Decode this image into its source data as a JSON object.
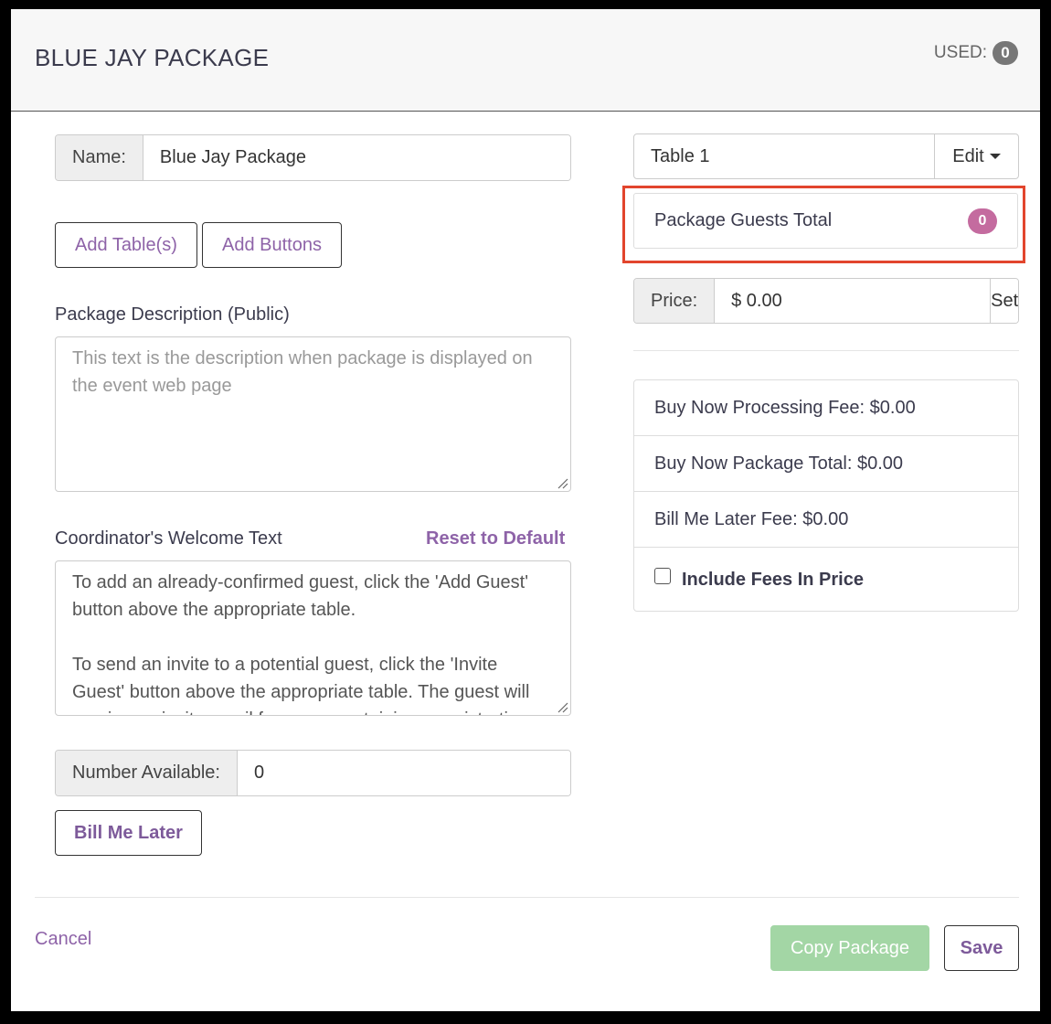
{
  "header": {
    "title": "BLUE JAY PACKAGE",
    "used_label": "USED:",
    "used_count": "0"
  },
  "form": {
    "name_label": "Name:",
    "name_value": "Blue Jay Package",
    "add_tables_label": "Add Table(s)",
    "add_buttons_label": "Add Buttons",
    "description_label": "Package Description (Public)",
    "description_placeholder": "This text is the description when package is displayed on the event web page",
    "welcome_label": "Coordinator's Welcome Text",
    "reset_default_label": "Reset to Default",
    "welcome_text_p1": "To add an already-confirmed guest, click the 'Add Guest' button above the appropriate table.",
    "welcome_text_p2": "To send an invite to a potential guest, click the 'Invite Guest' button above the appropriate table. The guest will receive an invite email from you containing a registration",
    "number_available_label": "Number Available:",
    "number_available_value": "0",
    "bill_me_later_label": "Bill Me Later"
  },
  "side": {
    "table_select_value": "Table 1",
    "edit_label": "Edit",
    "guests_total_label": "Package Guests Total",
    "guests_total_count": "0",
    "price_label": "Price:",
    "price_value": "$ 0.00",
    "set_label": "Set",
    "fees": {
      "processing_fee": "Buy Now Processing Fee: $0.00",
      "package_total": "Buy Now Package Total: $0.00",
      "bill_later_fee": "Bill Me Later Fee: $0.00",
      "include_fees_label": "Include Fees In Price"
    }
  },
  "footer": {
    "cancel_label": "Cancel",
    "copy_label": "Copy Package",
    "save_label": "Save"
  },
  "colors": {
    "accent_purple": "#8e63a8",
    "badge_pink": "#c46b9f",
    "highlight_red": "#e2452d",
    "copy_green": "#a3d6a5"
  }
}
